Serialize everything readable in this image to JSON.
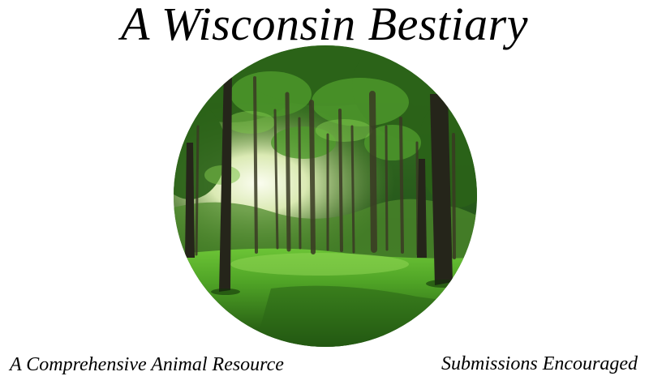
{
  "header": {
    "title": "A Wisconsin Bestiary"
  },
  "hero": {
    "image_subject": "sunlit-forest-clearing",
    "colors": {
      "grass_light": "#5db82e",
      "grass_dark": "#1e5210",
      "canopy": "#2f6a1e",
      "sky_glow": "#f4f8e0",
      "trunk": "#2a2a1c"
    }
  },
  "links": {
    "left_label": "A Comprehensive Animal Resource",
    "right_label": "Submissions Encouraged"
  }
}
